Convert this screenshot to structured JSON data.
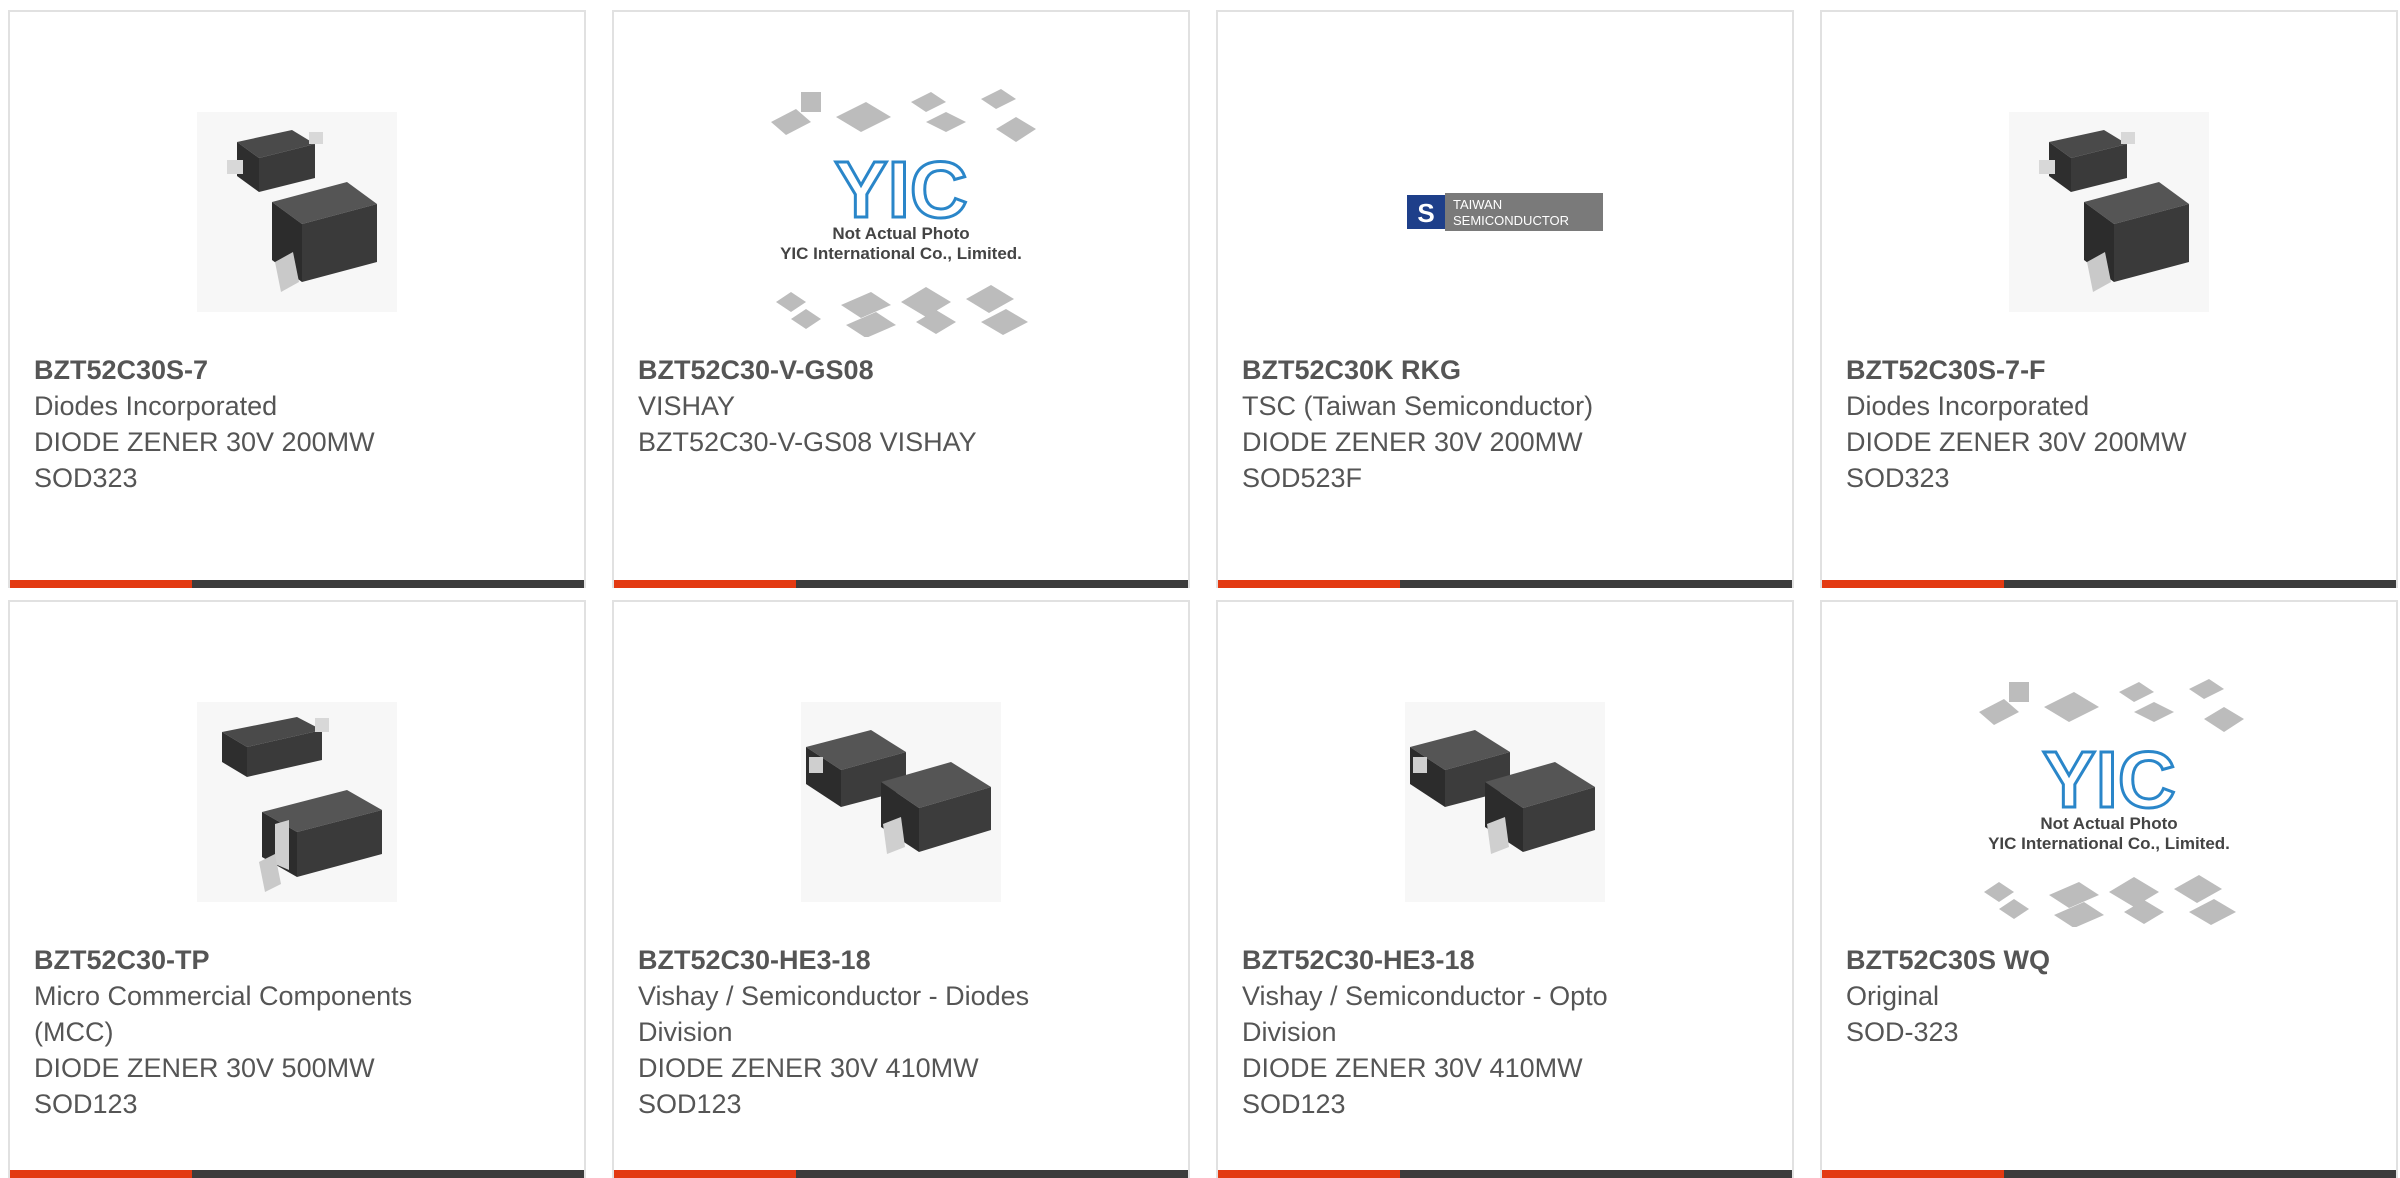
{
  "cards": [
    {
      "part": "BZT52C30S-7",
      "lines": [
        "Diodes Incorporated",
        "DIODE ZENER 30V 200MW",
        "SOD323"
      ],
      "image": "sod323-diode-photo"
    },
    {
      "part": "BZT52C30-V-GS08",
      "lines": [
        "VISHAY",
        "BZT52C30-V-GS08 VISHAY"
      ],
      "image": "yic-placeholder-photo",
      "placeholder": {
        "brand": "YIC",
        "caption1": "Not Actual Photo",
        "caption2": "YIC International Co., Limited."
      }
    },
    {
      "part": "BZT52C30K RKG",
      "lines": [
        "TSC (Taiwan Semiconductor)",
        "DIODE ZENER 30V 200MW",
        "SOD523F"
      ],
      "image": "taiwan-semiconductor-logo",
      "logo": {
        "line1": "TAIWAN",
        "line2": "SEMICONDUCTOR"
      }
    },
    {
      "part": "BZT52C30S-7-F",
      "lines": [
        "Diodes Incorporated",
        "DIODE ZENER 30V 200MW",
        "SOD323"
      ],
      "image": "sod323-diode-photo"
    },
    {
      "part": "BZT52C30-TP",
      "lines": [
        "Micro Commercial Components",
        "(MCC)",
        "DIODE ZENER 30V 500MW",
        "SOD123"
      ],
      "image": "sod123-diode-photo"
    },
    {
      "part": "BZT52C30-HE3-18",
      "lines": [
        "Vishay / Semiconductor - Diodes",
        "Division",
        "DIODE ZENER 30V 410MW",
        "SOD123"
      ],
      "image": "sod123-pair-photo"
    },
    {
      "part": "BZT52C30-HE3-18",
      "lines": [
        "Vishay / Semiconductor - Opto",
        "Division",
        "DIODE ZENER 30V 410MW",
        "SOD123"
      ],
      "image": "sod123-pair-photo"
    },
    {
      "part": "BZT52C30S WQ",
      "lines": [
        "Original",
        "SOD-323"
      ],
      "image": "yic-placeholder-photo",
      "placeholder": {
        "brand": "YIC",
        "caption1": "Not Actual Photo",
        "caption2": "YIC International Co., Limited."
      }
    }
  ],
  "colors": {
    "accent": "#e33a12",
    "bar": "#3c3c3c",
    "border": "#e1e1e1",
    "text": "#555555",
    "yic_blue": "#2a86c9"
  }
}
